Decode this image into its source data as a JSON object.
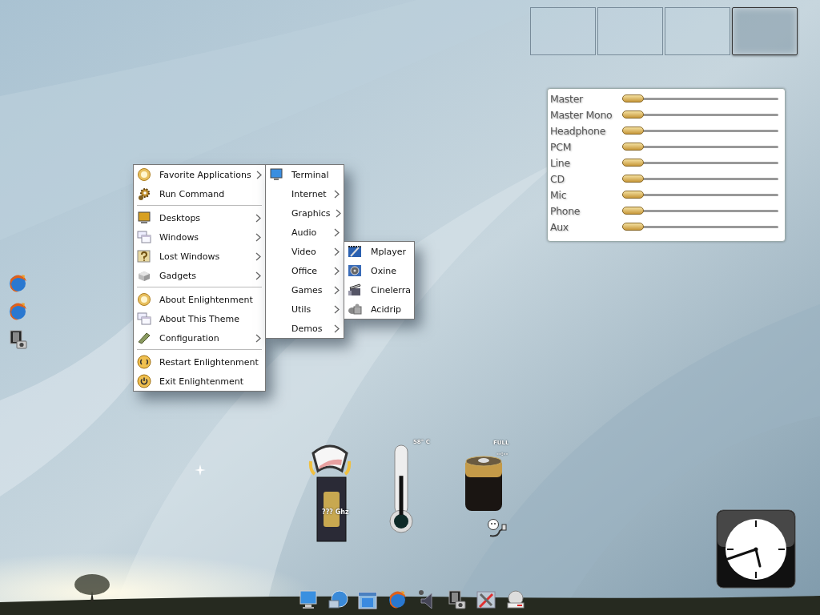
{
  "pager": {
    "desktops": [
      {
        "selected": false
      },
      {
        "selected": false
      },
      {
        "selected": false
      },
      {
        "selected": true
      }
    ]
  },
  "mixer": {
    "channels": [
      {
        "name": "Master",
        "level": 0
      },
      {
        "name": "Master Mono",
        "level": 0
      },
      {
        "name": "Headphone",
        "level": 0
      },
      {
        "name": "PCM",
        "level": 0
      },
      {
        "name": "Line",
        "level": 0
      },
      {
        "name": "CD",
        "level": 0
      },
      {
        "name": "Mic",
        "level": 0
      },
      {
        "name": "Phone",
        "level": 0
      },
      {
        "name": "Aux",
        "level": 0
      }
    ]
  },
  "main_menu": {
    "sections": [
      {
        "items": [
          {
            "label": "Favorite Applications",
            "submenu": true
          },
          {
            "label": "Run Command",
            "submenu": false
          }
        ]
      },
      {
        "items": [
          {
            "label": "Desktops",
            "submenu": true
          },
          {
            "label": "Windows",
            "submenu": true
          },
          {
            "label": "Lost Windows",
            "submenu": true
          },
          {
            "label": "Gadgets",
            "submenu": true
          }
        ]
      },
      {
        "items": [
          {
            "label": "About Enlightenment",
            "submenu": false
          },
          {
            "label": "About This Theme",
            "submenu": false
          },
          {
            "label": "Configuration",
            "submenu": true
          }
        ]
      },
      {
        "items": [
          {
            "label": "Restart Enlightenment",
            "submenu": false
          },
          {
            "label": "Exit Enlightenment",
            "submenu": false
          }
        ]
      }
    ]
  },
  "apps_menu": {
    "items": [
      {
        "label": "Terminal",
        "submenu": false
      },
      {
        "label": "Internet",
        "submenu": true
      },
      {
        "label": "Graphics",
        "submenu": true
      },
      {
        "label": "Audio",
        "submenu": true
      },
      {
        "label": "Video",
        "submenu": true
      },
      {
        "label": "Office",
        "submenu": true
      },
      {
        "label": "Games",
        "submenu": true
      },
      {
        "label": "Utils",
        "submenu": true
      },
      {
        "label": "Demos",
        "submenu": true
      }
    ]
  },
  "video_menu": {
    "items": [
      {
        "label": "Mplayer"
      },
      {
        "label": "Oxine"
      },
      {
        "label": "Cinelerra"
      },
      {
        "label": "Acidrip"
      }
    ]
  },
  "gadgets": {
    "cpu": {
      "reading": "??? Ghz"
    },
    "temperature": {
      "reading": "58° C",
      "level": 0.6
    },
    "battery": {
      "status": "FULL",
      "time": "--:--"
    }
  }
}
